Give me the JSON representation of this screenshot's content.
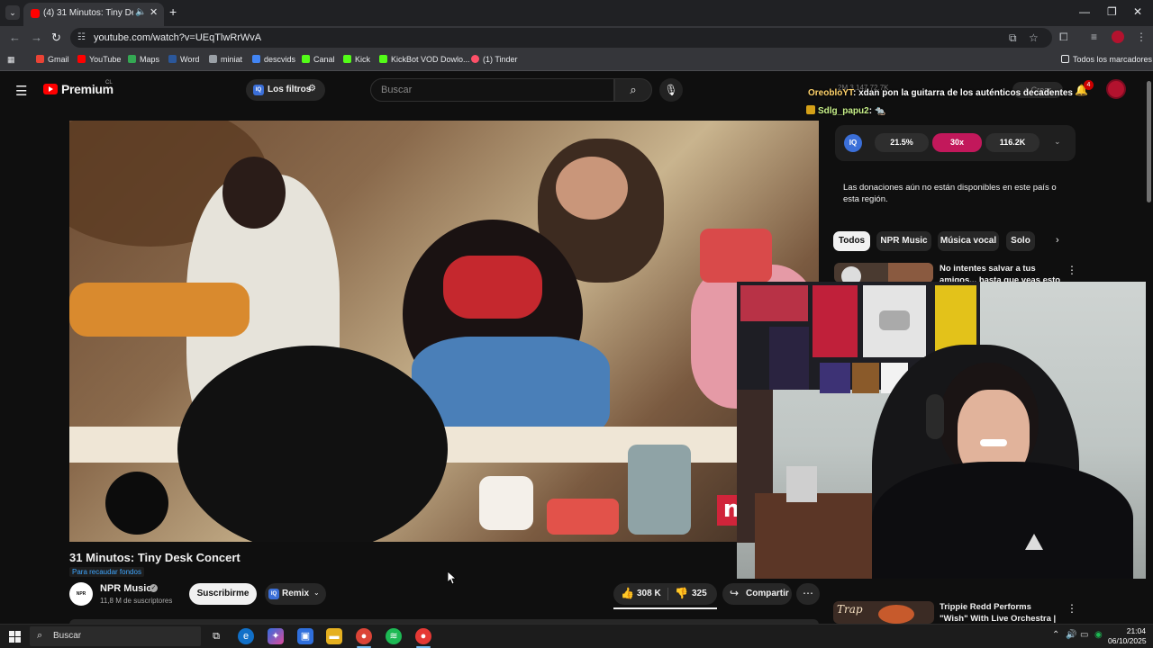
{
  "browser": {
    "tab_title": "(4) 31 Minutos: Tiny Desk C",
    "url": "youtube.com/watch?v=UEqTlwRrWvA",
    "bookmarks": [
      {
        "label": "Gmail",
        "color": "#ea4335"
      },
      {
        "label": "YouTube",
        "color": "#ff0000"
      },
      {
        "label": "Maps",
        "color": "#34a853"
      },
      {
        "label": "Word",
        "color": "#2b579a"
      },
      {
        "label": "miniat",
        "color": "#9aa0a6"
      },
      {
        "label": "descvids",
        "color": "#4285f4"
      },
      {
        "label": "Canal",
        "color": "#53fc18"
      },
      {
        "label": "Kick",
        "color": "#53fc18"
      },
      {
        "label": "KickBot VOD Dowlo...",
        "color": "#53fc18"
      },
      {
        "label": "(1) Tinder",
        "color": "#fd5068"
      }
    ],
    "all_bookmarks": "Todos los marcadores"
  },
  "youtube": {
    "brand": "Premium",
    "country": "CL",
    "filters_label": "Los filtros",
    "search_placeholder": "Buscar",
    "notification_count": "4",
    "create_label": "+ Crear",
    "header_stats": "2M  3,147  72.7K"
  },
  "video": {
    "title": "31 Minutos: Tiny Desk Concert",
    "tag": "Para recaudar fondos",
    "channel": "NPR Music",
    "channel_avatar": "NPR Music",
    "subscribers": "11,8 M de suscriptores",
    "subscribe_label": "Suscribirme",
    "remix_label": "Remix",
    "likes": "308 K",
    "dislikes": "325",
    "share_label": "Compartir",
    "npr_letter": "n"
  },
  "chat": [
    {
      "user": "OreobloYT",
      "message": ": xdan pon la guitarra de los auténticos decadentes"
    },
    {
      "user": "Sdlg_papu2",
      "message": ":"
    }
  ],
  "iq_bar": {
    "logo": "IQ",
    "stat1": "21.5%",
    "stat2": "30x",
    "stat3": "116.2K"
  },
  "donation_notice": "Las donaciones aún no están disponibles en este país o esta región.",
  "chips": [
    "Todos",
    "NPR Music",
    "Música vocal",
    "Solo"
  ],
  "recommendations": [
    {
      "title": "No intentes salvar a tus amigos... hasta que veas esto"
    },
    {
      "title": "Trippie Redd Performs \"Wish\" With Live Orchestra | ...",
      "thumb_text": "Trap"
    }
  ],
  "taskbar": {
    "search_label": "Buscar",
    "time": "21:04",
    "date": "06/10/2025"
  }
}
